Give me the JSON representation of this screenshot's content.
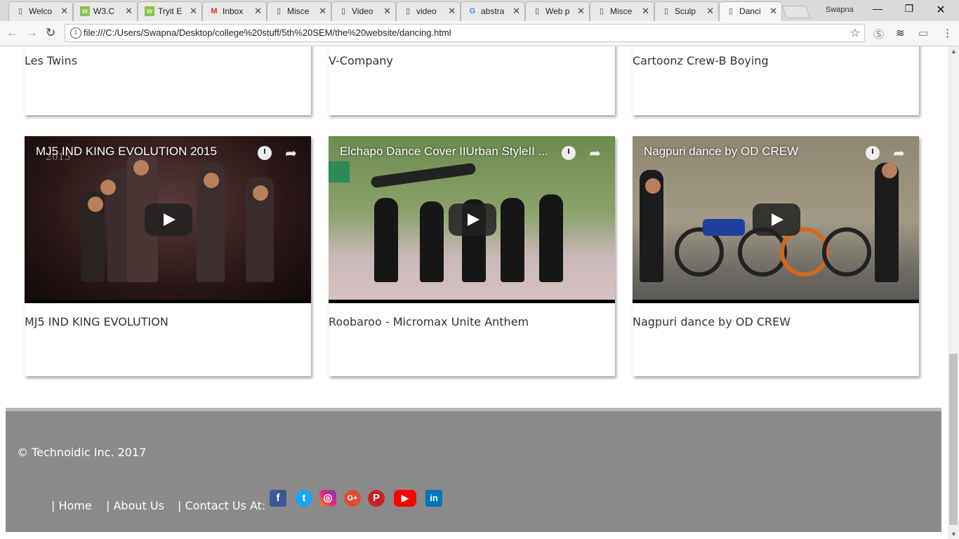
{
  "browser": {
    "tabs": [
      {
        "title": "Welco",
        "icon": "page-icon"
      },
      {
        "title": "W3.C",
        "icon": "w3schools-icon"
      },
      {
        "title": "Tryit E",
        "icon": "w3schools-icon"
      },
      {
        "title": "Inbox",
        "icon": "gmail-icon"
      },
      {
        "title": "Misce",
        "icon": "page-icon"
      },
      {
        "title": "Video",
        "icon": "page-icon"
      },
      {
        "title": "video",
        "icon": "page-icon"
      },
      {
        "title": "abstra",
        "icon": "google-icon"
      },
      {
        "title": "Web p",
        "icon": "page-icon"
      },
      {
        "title": "Misce",
        "icon": "page-icon"
      },
      {
        "title": "Sculp",
        "icon": "page-icon"
      },
      {
        "title": "Danci",
        "icon": "page-icon",
        "active": true
      }
    ],
    "user": "Swapna",
    "url": "file:///C:/Users/Swapna/Desktop/college%20stuff/5th%20SEM/the%20website/dancing.html"
  },
  "cards_top_row": [
    {
      "caption": "Les Twins"
    },
    {
      "caption": "V-Company"
    },
    {
      "caption": "Cartoonz Crew-B Boying"
    }
  ],
  "cards_video_row": [
    {
      "video_title": "MJ5 IND KING EVOLUTION 2015",
      "caption": "MJ5 IND KING EVOLUTION",
      "year_watermark": "2015"
    },
    {
      "video_title": "Elchapo Dance Cover IIUrban StyleII ...",
      "caption": "Roobaroo - Micromax Unite Anthem"
    },
    {
      "video_title": "Nagpuri dance by OD CREW",
      "caption": "Nagpuri dance by OD CREW"
    }
  ],
  "footer": {
    "copyright": "© Technoidic Inc. 2017",
    "links": [
      "| Home",
      "| About Us",
      "| Contact Us At:"
    ],
    "social": [
      {
        "name": "facebook-icon",
        "glyph": "f",
        "color": "#3b5998"
      },
      {
        "name": "twitter-icon",
        "glyph": "t",
        "color": "#1da1f2"
      },
      {
        "name": "instagram-icon",
        "glyph": "◎",
        "color": "#c13584"
      },
      {
        "name": "google-plus-icon",
        "glyph": "G+",
        "color": "#dd4b39"
      },
      {
        "name": "pinterest-icon",
        "glyph": "P",
        "color": "#cb2027"
      },
      {
        "name": "youtube-icon",
        "glyph": "▶",
        "color": "#ff0000"
      },
      {
        "name": "linkedin-icon",
        "glyph": "in",
        "color": "#0077b5"
      }
    ]
  },
  "colors": {
    "footer_bg": "#8a8a8a",
    "footer_border": "#b5b5b5"
  }
}
